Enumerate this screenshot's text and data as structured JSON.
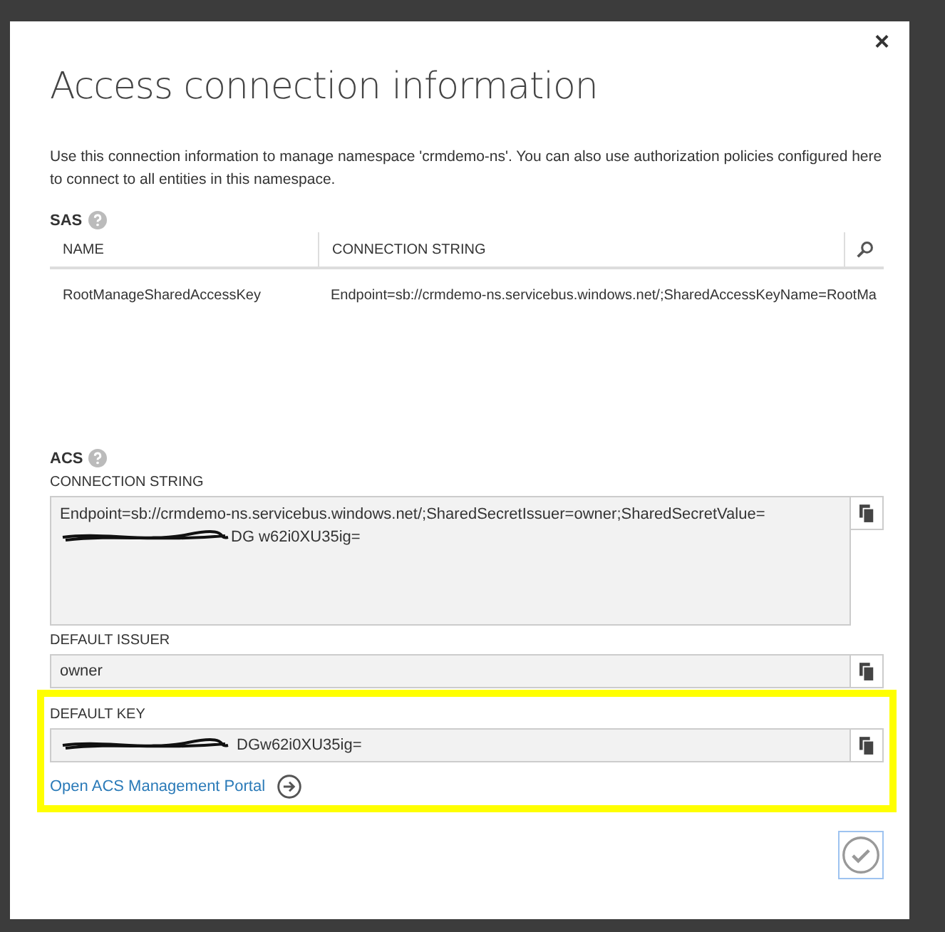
{
  "dialog": {
    "title": "Access connection information",
    "close": "×",
    "description": "Use this connection information to manage namespace 'crmdemo-ns'. You can also use authorization policies configured here to connect to all entities in this namespace."
  },
  "sas": {
    "label": "SAS",
    "table": {
      "columns": [
        "NAME",
        "CONNECTION STRING"
      ],
      "rows": [
        {
          "name": "RootManageSharedAccessKey",
          "connection_string": "Endpoint=sb://crmdemo-ns.servicebus.windows.net/;SharedAccessKeyName=RootMa"
        }
      ]
    }
  },
  "acs": {
    "label": "ACS",
    "fields": [
      {
        "label": "CONNECTION STRING",
        "kind": "multiline",
        "value": "Endpoint=sb://crmdemo-ns.servicebus.windows.net/;SharedSecretIssuer=owner;SharedSecretValue=",
        "redacted": true,
        "tail": "DG w62i0XU35ig="
      },
      {
        "label": "DEFAULT ISSUER",
        "kind": "single",
        "value": "owner",
        "redacted": false
      },
      {
        "label": "DEFAULT KEY",
        "kind": "single",
        "redacted": true,
        "tail": "DGw62i0XU35ig="
      }
    ],
    "portal_link": "Open ACS Management Portal"
  }
}
